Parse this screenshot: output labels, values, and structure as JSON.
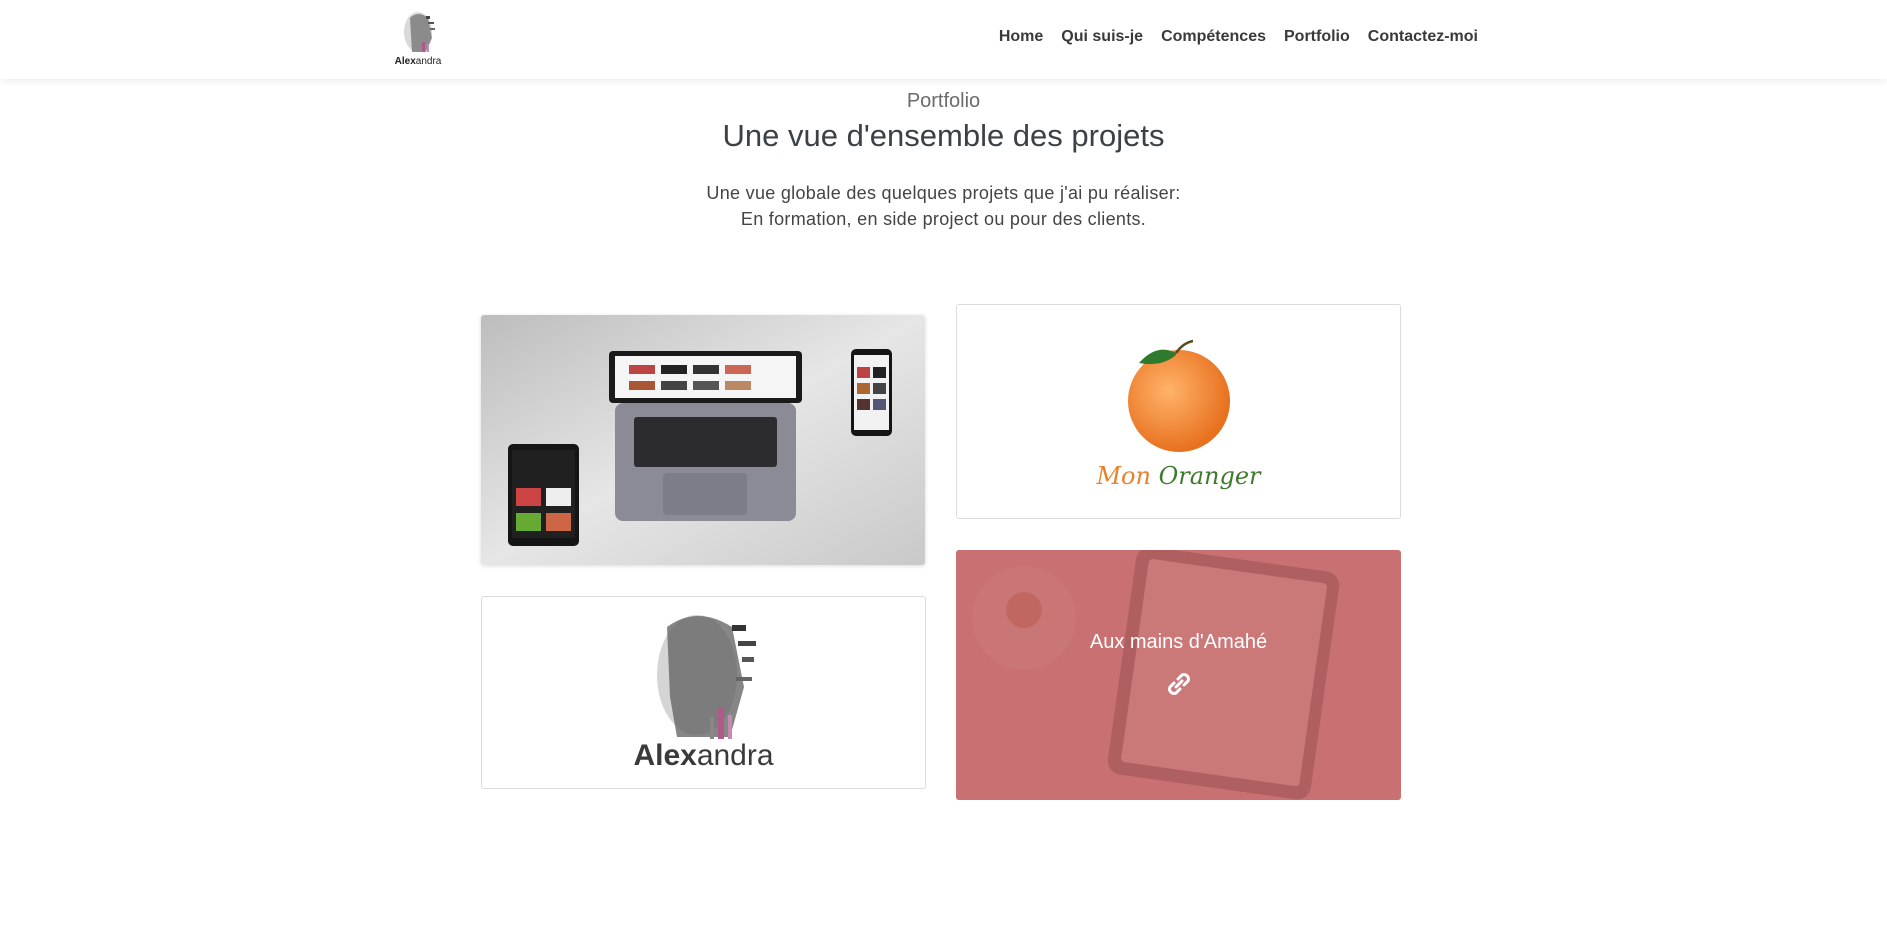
{
  "header": {
    "logo_text_bold": "Alex",
    "logo_text_light": "andra",
    "nav": [
      "Home",
      "Qui suis-je",
      "Compétences",
      "Portfolio",
      "Contactez-moi"
    ]
  },
  "section": {
    "kicker": "Portfolio",
    "title": "Une vue d'ensemble des projets",
    "desc_line1": "Une vue globale des quelques projets que j'ai pu réaliser:",
    "desc_line2": "En formation, en side project ou pour des clients."
  },
  "cards": {
    "card2": {
      "logo_word1": "Mon",
      "logo_word2": "Oranger"
    },
    "card3": {
      "logo_bold": "Alex",
      "logo_light": "andra"
    },
    "card4": {
      "title": "Aux mains d'Amahé"
    }
  },
  "icons": [
    "link-icon"
  ],
  "colors": {
    "overlay": "#c46568",
    "nav_text": "#3a3a3a",
    "orange": "#e8812c",
    "green": "#3f7a2e"
  }
}
